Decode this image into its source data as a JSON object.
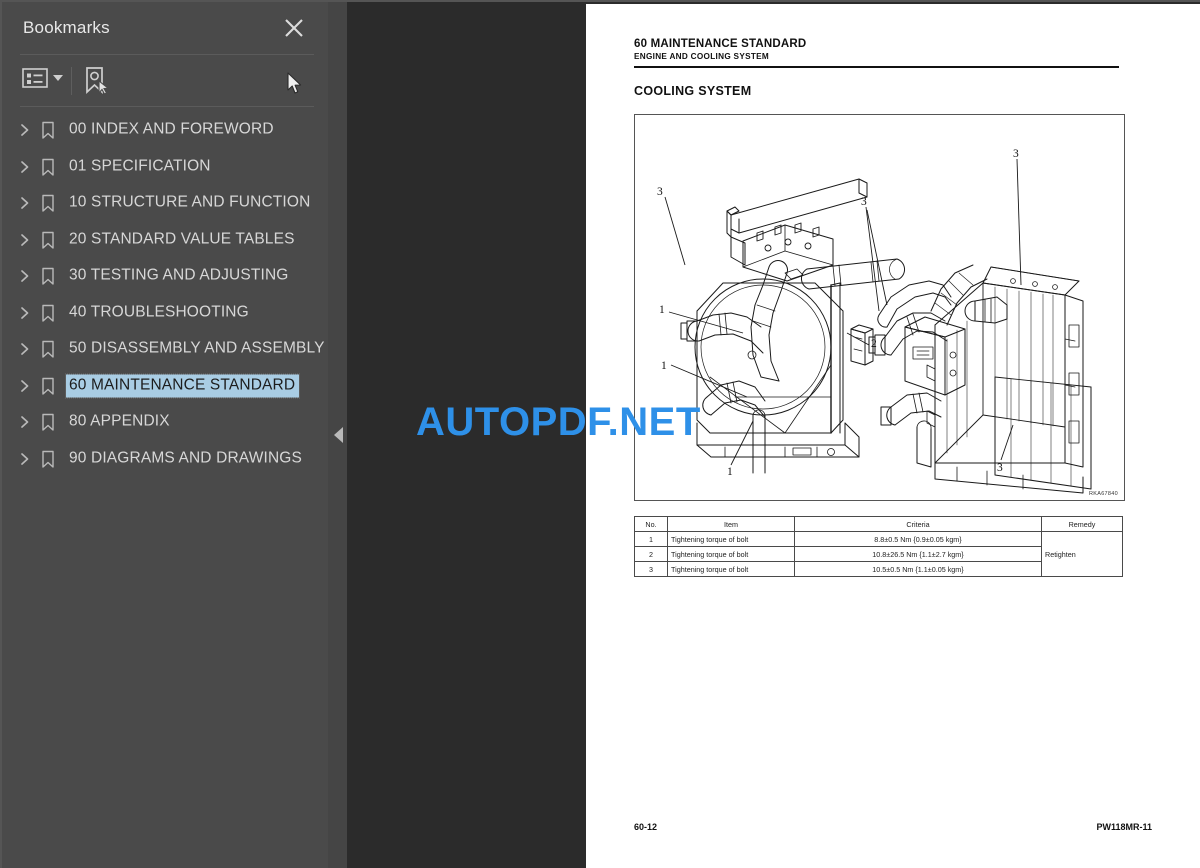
{
  "sidebar": {
    "title": "Bookmarks",
    "close_icon": "close-icon",
    "toolbar": {
      "options_icon": "list-options-icon",
      "chevron_icon": "chevron-down-icon",
      "find_bookmark_icon": "bookmark-pointer-icon"
    },
    "items": [
      {
        "label": "00 INDEX AND FOREWORD",
        "selected": false
      },
      {
        "label": "01 SPECIFICATION",
        "selected": false
      },
      {
        "label": "10 STRUCTURE AND FUNCTION",
        "selected": false
      },
      {
        "label": "20 STANDARD VALUE TABLES",
        "selected": false
      },
      {
        "label": "30 TESTING AND ADJUSTING",
        "selected": false
      },
      {
        "label": "40 TROUBLESHOOTING",
        "selected": false
      },
      {
        "label": "50 DISASSEMBLY AND ASSEMBLY",
        "selected": false
      },
      {
        "label": "60 MAINTENANCE STANDARD",
        "selected": true
      },
      {
        "label": "80 APPENDIX",
        "selected": false
      },
      {
        "label": "90 DIAGRAMS AND DRAWINGS",
        "selected": false
      }
    ]
  },
  "viewer": {
    "collapse_handle_icon": "triangle-left-icon",
    "watermark": "AUTOPDF.NET",
    "watermark_color": "#2e90e8"
  },
  "page": {
    "header_number": "60 MAINTENANCE STANDARD",
    "header_subtitle": "ENGINE AND COOLING SYSTEM",
    "section_title": "COOLING SYSTEM",
    "figure_code": "RKA67840",
    "figure_callouts": [
      "3",
      "3",
      "3",
      "1",
      "1",
      "1",
      "2",
      "3",
      "3"
    ],
    "footer_left": "60-12",
    "footer_right": "PW118MR-11",
    "table": {
      "headers": [
        "No.",
        "Item",
        "Criteria",
        "Remedy"
      ],
      "rows": [
        {
          "no": "1",
          "item": "Tightening torque of bolt",
          "criteria": "8.8±0.5 Nm {0.9±0.05 kgm}",
          "remedy": ""
        },
        {
          "no": "2",
          "item": "Tightening torque of bolt",
          "criteria": "10.8±26.5 Nm {1.1±2.7 kgm}",
          "remedy": "Retighten"
        },
        {
          "no": "3",
          "item": "Tightening torque of bolt",
          "criteria": "10.5±0.5 Nm {1.1±0.05 kgm}",
          "remedy": ""
        }
      ]
    }
  }
}
